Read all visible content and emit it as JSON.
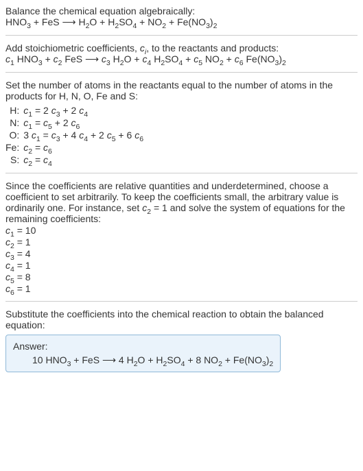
{
  "intro": {
    "line1": "Balance the chemical equation algebraically:",
    "line2": "HNO<sub>3</sub> + FeS ⟶ H<sub>2</sub>O + H<sub>2</sub>SO<sub>4</sub> + NO<sub>2</sub> + Fe(NO<sub>3</sub>)<sub>2</sub>"
  },
  "stoich": {
    "line1": "Add stoichiometric coefficients, <span class=\"i\">c<sub>i</sub></span>, to the reactants and products:",
    "line2": "<span class=\"i\">c</span><sub>1</sub> HNO<sub>3</sub> + <span class=\"i\">c</span><sub>2</sub> FeS ⟶ <span class=\"i\">c</span><sub>3</sub> H<sub>2</sub>O + <span class=\"i\">c</span><sub>4</sub> H<sub>2</sub>SO<sub>4</sub> + <span class=\"i\">c</span><sub>5</sub> NO<sub>2</sub> + <span class=\"i\">c</span><sub>6</sub> Fe(NO<sub>3</sub>)<sub>2</sub>"
  },
  "atoms": {
    "intro": "Set the number of atoms in the reactants equal to the number of atoms in the products for H, N, O, Fe and S:",
    "rows": [
      {
        "el": "H:",
        "eq": "<span class=\"i\">c</span><sub>1</sub> = 2 <span class=\"i\">c</span><sub>3</sub> + 2 <span class=\"i\">c</span><sub>4</sub>"
      },
      {
        "el": "N:",
        "eq": "<span class=\"i\">c</span><sub>1</sub> = <span class=\"i\">c</span><sub>5</sub> + 2 <span class=\"i\">c</span><sub>6</sub>"
      },
      {
        "el": "O:",
        "eq": "3 <span class=\"i\">c</span><sub>1</sub> = <span class=\"i\">c</span><sub>3</sub> + 4 <span class=\"i\">c</span><sub>4</sub> + 2 <span class=\"i\">c</span><sub>5</sub> + 6 <span class=\"i\">c</span><sub>6</sub>"
      },
      {
        "el": "Fe:",
        "eq": "<span class=\"i\">c</span><sub>2</sub> = <span class=\"i\">c</span><sub>6</sub>"
      },
      {
        "el": "S:",
        "eq": "<span class=\"i\">c</span><sub>2</sub> = <span class=\"i\">c</span><sub>4</sub>"
      }
    ]
  },
  "solve": {
    "intro": "Since the coefficients are relative quantities and underdetermined, choose a coefficient to set arbitrarily. To keep the coefficients small, the arbitrary value is ordinarily one. For instance, set <span class=\"i\">c</span><sub>2</sub> = 1 and solve the system of equations for the remaining coefficients:",
    "coeffs": [
      "<span class=\"i\">c</span><sub>1</sub> = 10",
      "<span class=\"i\">c</span><sub>2</sub> = 1",
      "<span class=\"i\">c</span><sub>3</sub> = 4",
      "<span class=\"i\">c</span><sub>4</sub> = 1",
      "<span class=\"i\">c</span><sub>5</sub> = 8",
      "<span class=\"i\">c</span><sub>6</sub> = 1"
    ]
  },
  "final": {
    "intro": "Substitute the coefficients into the chemical reaction to obtain the balanced equation:",
    "answer_label": "Answer:",
    "answer_eq": "10 HNO<sub>3</sub> + FeS ⟶ 4 H<sub>2</sub>O + H<sub>2</sub>SO<sub>4</sub> + 8 NO<sub>2</sub> + Fe(NO<sub>3</sub>)<sub>2</sub>"
  }
}
